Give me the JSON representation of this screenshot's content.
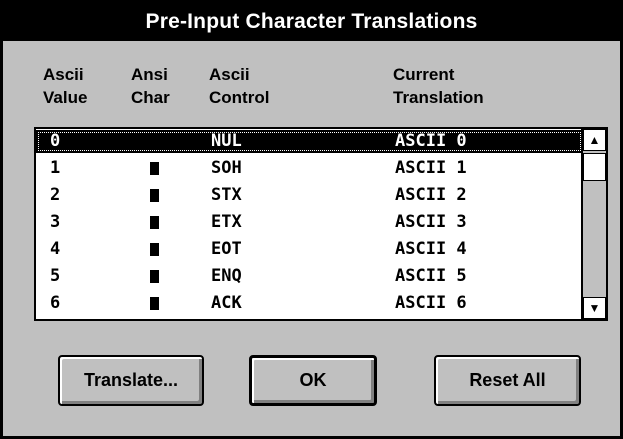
{
  "dialog": {
    "title": "Pre-Input Character Translations"
  },
  "columns": {
    "ascii_value": [
      "Ascii",
      "Value"
    ],
    "ansi_char": [
      "Ansi",
      "Char"
    ],
    "ascii_control": [
      "Ascii",
      "Control"
    ],
    "current_translation": [
      "Current",
      "Translation"
    ]
  },
  "rows": [
    {
      "value": "0",
      "ansi": "■",
      "control": "NUL",
      "translation": "ASCII 0",
      "selected": true
    },
    {
      "value": "1",
      "ansi": "■",
      "control": "SOH",
      "translation": "ASCII 1"
    },
    {
      "value": "2",
      "ansi": "■",
      "control": "STX",
      "translation": "ASCII 2"
    },
    {
      "value": "3",
      "ansi": "■",
      "control": "ETX",
      "translation": "ASCII 3"
    },
    {
      "value": "4",
      "ansi": "■",
      "control": "EOT",
      "translation": "ASCII 4"
    },
    {
      "value": "5",
      "ansi": "■",
      "control": "ENQ",
      "translation": "ASCII 5"
    },
    {
      "value": "6",
      "ansi": "■",
      "control": "ACK",
      "translation": "ASCII 6"
    }
  ],
  "scrollbar": {
    "up_icon": "arrow-up-icon",
    "down_icon": "arrow-down-icon",
    "up_glyph": "▲",
    "down_glyph": "▼"
  },
  "buttons": {
    "translate": "Translate...",
    "ok": "OK",
    "reset_all": "Reset All"
  },
  "colors": {
    "dialog_bg": "#c0c0c0",
    "titlebar_bg": "#000000",
    "titlebar_text": "#ffffff",
    "selection_bg": "#000000",
    "list_bg": "#ffffff"
  }
}
